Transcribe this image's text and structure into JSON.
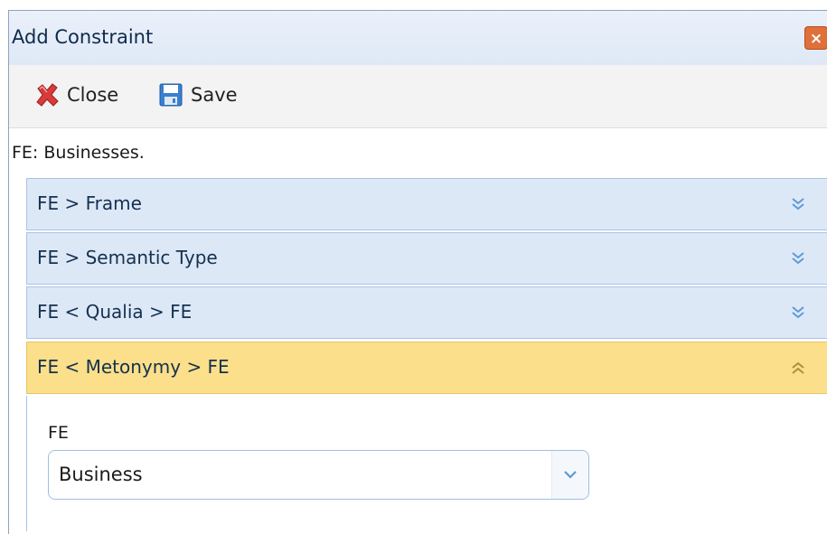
{
  "window": {
    "title": "Add Constraint",
    "close_glyph": "×"
  },
  "toolbar": {
    "close_label": "Close",
    "close_icon": "red-x-icon",
    "save_label": "Save",
    "save_icon": "floppy-disk-icon"
  },
  "context": {
    "fe_label": "FE: Businesses."
  },
  "accordion": {
    "items": [
      {
        "label": "FE > Frame",
        "expanded": false
      },
      {
        "label": "FE > Semantic Type",
        "expanded": false
      },
      {
        "label": "FE < Qualia > FE",
        "expanded": false
      },
      {
        "label": "FE < Metonymy > FE",
        "expanded": true
      }
    ],
    "collapsed_icon": "double-chevron-down-icon",
    "expanded_icon": "double-chevron-up-icon"
  },
  "panel": {
    "field_label": "FE",
    "select_value": "Business"
  },
  "colors": {
    "header_bg": "#dde8f7",
    "active_bg": "#fbdf8a",
    "accent": "#5b9bd5",
    "close_red": "#e0703a"
  }
}
